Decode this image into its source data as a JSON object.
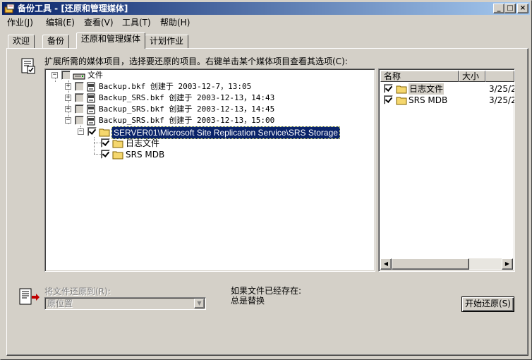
{
  "window": {
    "title": "备份工具 - [还原和管理媒体]",
    "caption_buttons": {
      "minimize": "_",
      "maximize": "□",
      "close": "×"
    }
  },
  "menubar": [
    {
      "label": "作业(J)"
    },
    {
      "label": "编辑(E)"
    },
    {
      "label": "查看(V)"
    },
    {
      "label": "工具(T)"
    },
    {
      "label": "帮助(H)"
    }
  ],
  "tabs": [
    {
      "label": "欢迎",
      "active": false
    },
    {
      "label": "备份",
      "active": false
    },
    {
      "label": "还原和管理媒体",
      "active": true
    },
    {
      "label": "计划作业",
      "active": false
    }
  ],
  "instruction": "扩展所需的媒体项目，选择要还原的项目。右键单击某个媒体项目查看其选项(C):",
  "tree": {
    "root": {
      "label": "文件",
      "icon": "file-drive-icon",
      "expander": "−"
    },
    "media": [
      {
        "label": "Backup.bkf 创建于 2003-12-7，13:05",
        "expander": "+"
      },
      {
        "label": "Backup_SRS.bkf 创建于 2003-12-13，14:43",
        "expander": "+"
      },
      {
        "label": "Backup_SRS.bkf 创建于 2003-12-13，14:45",
        "expander": "+"
      },
      {
        "label": "Backup_SRS.bkf 创建于 2003-12-13，15:00",
        "expander": "−"
      }
    ],
    "server_node": {
      "label": "SERVER01\\Microsoft Site Replication Service\\SRS Storage",
      "expander": "−",
      "checked": true
    },
    "children": [
      {
        "label": "日志文件",
        "checked": true
      },
      {
        "label": "SRS MDB",
        "checked": true
      }
    ]
  },
  "listview": {
    "columns": [
      {
        "label": "名称"
      },
      {
        "label": "大小"
      },
      {
        "label": ""
      }
    ],
    "rows": [
      {
        "name": "日志文件",
        "size": "",
        "modified": "3/25/2",
        "checked": true
      },
      {
        "name": "SRS MDB",
        "size": "",
        "modified": "3/25/2",
        "checked": true
      }
    ],
    "scroll_left": "◀",
    "scroll_right": "▶"
  },
  "restore": {
    "label": "将文件还原到(R):",
    "value": "原位置",
    "dropdown_glyph": "▼"
  },
  "if_exists": {
    "label": "如果文件已经存在:",
    "value": "总是替换"
  },
  "start_button": "开始还原(S)",
  "colors": {
    "title_start": "#0a246a",
    "title_end": "#a6caf0",
    "selection": "#0a246a",
    "folder": "#f5d76e",
    "face": "#d4d0c8"
  }
}
